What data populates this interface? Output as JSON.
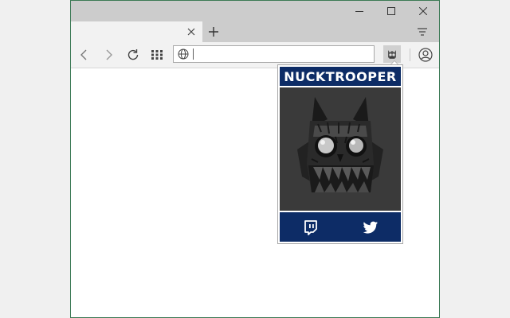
{
  "browser": {
    "address": {
      "value": "",
      "placeholder": ""
    }
  },
  "extension_popup": {
    "title": "NUCKTROOPER",
    "art_icon": "skull-mask-icon",
    "links": [
      {
        "name": "twitch",
        "icon": "twitch-icon"
      },
      {
        "name": "twitter",
        "icon": "twitter-bird-icon"
      }
    ]
  },
  "colors": {
    "popup_accent": "#0d2c66",
    "art_background": "#3a3a3a",
    "chrome_gray": "#cccccc",
    "toolbar_gray": "#f2f2f2"
  }
}
